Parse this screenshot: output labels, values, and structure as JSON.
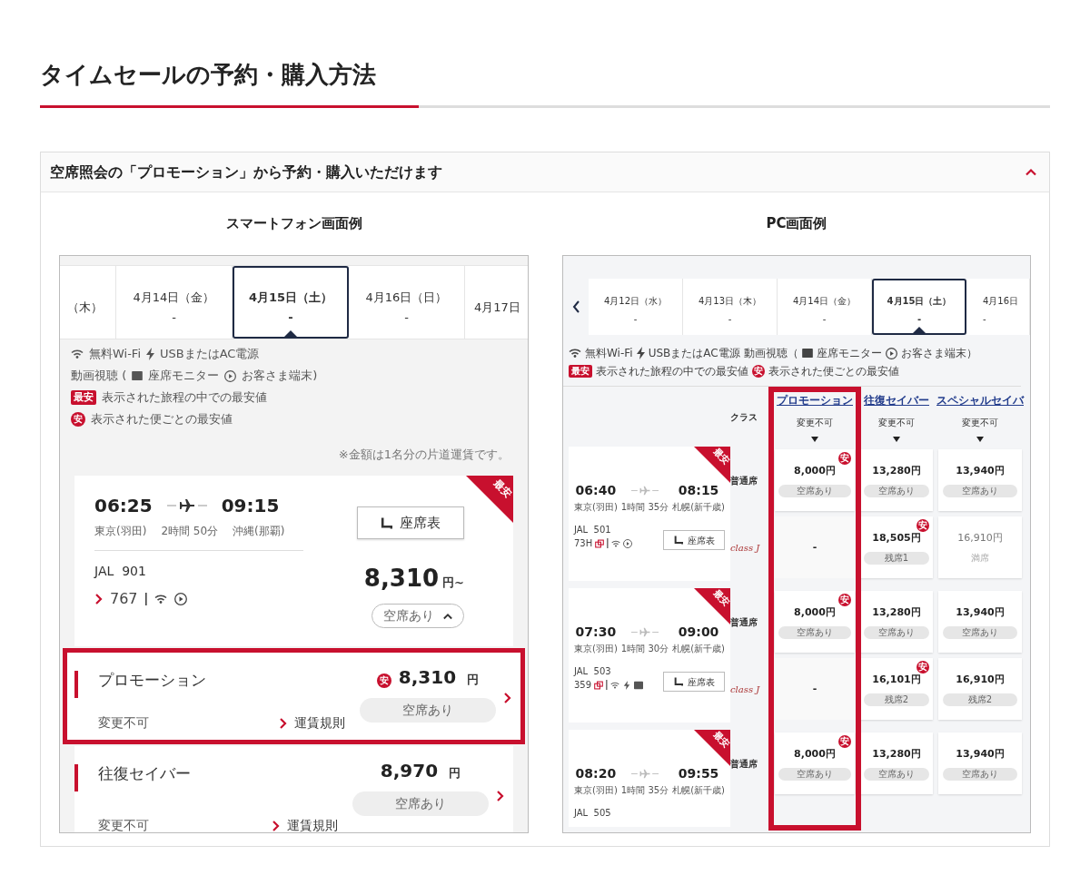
{
  "page_title": "タイムセールの予約・購入方法",
  "accordion": {
    "title": "空席照会の「プロモーション」から予約・購入いただけます",
    "expanded": true
  },
  "smartphone": {
    "caption": "スマートフォン画面例",
    "dates": [
      {
        "label": "（木）",
        "selected": false
      },
      {
        "label": "4月14日（金）",
        "price": "-",
        "selected": false
      },
      {
        "label": "4月15日（土）",
        "price": "-",
        "selected": true
      },
      {
        "label": "4月16日（日）",
        "price": "-",
        "selected": false
      },
      {
        "label": "4月17日",
        "selected": false
      }
    ],
    "legend": [
      [
        {
          "kind": "wifi",
          "text": "無料Wi-Fi"
        },
        {
          "kind": "bolt",
          "text": "USBまたはAC電源"
        }
      ],
      [
        {
          "kind": "plain",
          "text": "動画視聴 ("
        },
        {
          "kind": "monitor",
          "text": "座席モニター"
        },
        {
          "kind": "play",
          "text": "お客さま端末)"
        }
      ],
      [
        {
          "kind": "tag",
          "mark": "最安",
          "text": "表示された旅程の中での最安値"
        }
      ],
      [
        {
          "kind": "circle",
          "mark": "安",
          "text": "表示された便ごとの最安値"
        }
      ]
    ],
    "note": "※金額は1名分の片道運賃です。",
    "flight": {
      "ribbon": "最安",
      "departure": "06:25",
      "arrival": "09:15",
      "from": "東京(羽田)",
      "duration": "2時間 50分",
      "to": "沖縄(那覇)",
      "flight_no": "JAL  901",
      "aircraft": "767",
      "seat_map": "座席表",
      "price": "8,310",
      "unit": "円~",
      "availability": "空席あり"
    },
    "fares": [
      {
        "name": "プロモーション",
        "badge": "安",
        "price": "8,310",
        "unit": "円",
        "availability": "空席あり",
        "condition": "変更不可",
        "rules": "運賃規則",
        "highlighted": true
      },
      {
        "name": "往復セイバー",
        "price": "8,970",
        "unit": "円",
        "availability": "空席あり",
        "condition": "変更不可",
        "rules": "運賃規則",
        "highlighted": false
      }
    ]
  },
  "pc": {
    "caption": "PC画面例",
    "dates": [
      {
        "label": "4月12日（水）",
        "price": "-",
        "selected": false
      },
      {
        "label": "4月13日（木）",
        "price": "-",
        "selected": false
      },
      {
        "label": "4月14日（金）",
        "price": "-",
        "selected": false
      },
      {
        "label": "4月15日（土）",
        "price": "-",
        "selected": true
      },
      {
        "label": "4月16日",
        "price": "-",
        "selected": false
      }
    ],
    "legend": [
      [
        {
          "kind": "wifi",
          "text": "無料Wi-Fi"
        },
        {
          "kind": "bolt",
          "text": "USBまたはAC電源"
        },
        {
          "kind": "plain",
          "text": "動画視聴（"
        },
        {
          "kind": "monitor",
          "text": "座席モニター"
        },
        {
          "kind": "play",
          "text": "お客さま端末）"
        }
      ],
      [
        {
          "kind": "tag",
          "mark": "最安",
          "text": "表示された旅程の中での最安値"
        },
        {
          "kind": "circle",
          "mark": "安",
          "text": "表示された便ごとの最安値"
        }
      ]
    ],
    "class_label": "クラス",
    "columns": [
      {
        "name": "プロモーション",
        "condition": "変更不可",
        "highlighted": true
      },
      {
        "name": "往復セイバー",
        "condition": "変更不可",
        "highlighted": false
      },
      {
        "name": "スペシャルセイバ",
        "condition": "変更不可",
        "highlighted": false
      }
    ],
    "flights": [
      {
        "ribbon": "最安",
        "departure": "06:40",
        "arrival": "08:15",
        "from": "東京(羽田)",
        "duration": "1時間 35分",
        "to": "札幌(新千歳)",
        "flight_no": "JAL  501",
        "aircraft": "73H",
        "seat_map": "座席表",
        "rows": [
          {
            "kind": "standard",
            "label": "普通席",
            "cells": [
              {
                "price": "8,000円",
                "status": "空席あり",
                "badge": "安",
                "disabled": false
              },
              {
                "price": "13,280円",
                "status": "空席あり",
                "disabled": false
              },
              {
                "price": "13,940円",
                "status": "空席あり",
                "disabled": false
              }
            ]
          },
          {
            "kind": "premium",
            "label": "class J",
            "cells": [
              {
                "price": "-",
                "disabled": false
              },
              {
                "price": "18,505円",
                "status": "残席1",
                "badge": "安",
                "disabled": false
              },
              {
                "price": "16,910円",
                "status": "満席",
                "disabled": true
              }
            ]
          }
        ]
      },
      {
        "ribbon": "最安",
        "departure": "07:30",
        "arrival": "09:00",
        "from": "東京(羽田)",
        "duration": "1時間 30分",
        "to": "札幌(新千歳)",
        "flight_no": "JAL  503",
        "aircraft": "359",
        "seat_map": "座席表",
        "rows": [
          {
            "kind": "standard",
            "label": "普通席",
            "cells": [
              {
                "price": "8,000円",
                "status": "空席あり",
                "badge": "安",
                "disabled": false
              },
              {
                "price": "13,280円",
                "status": "空席あり",
                "disabled": false
              },
              {
                "price": "13,940円",
                "status": "空席あり",
                "disabled": false
              }
            ]
          },
          {
            "kind": "premium",
            "label": "class J",
            "cells": [
              {
                "price": "-",
                "disabled": false
              },
              {
                "price": "16,101円",
                "status": "残席2",
                "badge": "安",
                "disabled": false
              },
              {
                "price": "16,910円",
                "status": "残席2",
                "disabled": false
              }
            ]
          }
        ]
      },
      {
        "ribbon": "最安",
        "departure": "08:20",
        "arrival": "09:55",
        "from": "東京(羽田)",
        "duration": "1時間 35分",
        "to": "札幌(新千歳)",
        "flight_no": "JAL  505",
        "rows": [
          {
            "kind": "standard",
            "label": "普通席",
            "cells": [
              {
                "price": "8,000円",
                "status": "空席あり",
                "badge": "安",
                "disabled": false
              },
              {
                "price": "13,280円",
                "status": "空席あり",
                "disabled": false
              },
              {
                "price": "13,940円",
                "status": "空席あり",
                "disabled": false
              }
            ]
          }
        ]
      }
    ]
  }
}
